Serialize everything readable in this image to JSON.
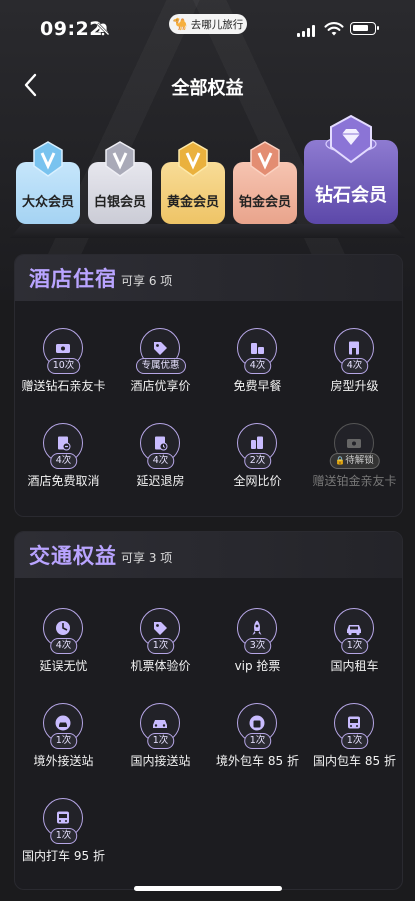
{
  "status": {
    "time": "09:22",
    "app_name": "去哪儿旅行"
  },
  "header": {
    "title": "全部权益"
  },
  "tiers": [
    {
      "label": "大众会员"
    },
    {
      "label": "白银会员"
    },
    {
      "label": "黄金会员"
    },
    {
      "label": "铂金会员"
    },
    {
      "label": "钻石会员",
      "selected": true
    }
  ],
  "hotel": {
    "title": "酒店住宿",
    "subtitle": "可享 6 项",
    "items": [
      {
        "badge": "10次",
        "label": "赠送钻石亲友卡",
        "icon": "ticket-icon"
      },
      {
        "badge": "专属优惠",
        "label": "酒店优享价",
        "icon": "price-tag-icon"
      },
      {
        "badge": "4次",
        "label": "免费早餐",
        "icon": "breakfast-icon"
      },
      {
        "badge": "4次",
        "label": "房型升级",
        "icon": "room-upgrade-icon"
      },
      {
        "badge": "4次",
        "label": "酒店免费取消",
        "icon": "cancel-doc-icon"
      },
      {
        "badge": "4次",
        "label": "延迟退房",
        "icon": "late-checkout-icon"
      },
      {
        "badge": "2次",
        "label": "全网比价",
        "icon": "price-compare-icon"
      },
      {
        "badge": "待解锁",
        "label": "赠送铂金亲友卡",
        "icon": "locked-ticket-icon",
        "locked": true
      }
    ]
  },
  "traffic": {
    "title": "交通权益",
    "subtitle": "可享 3 项",
    "items": [
      {
        "badge": "4次",
        "label": "延误无忧",
        "icon": "delay-clock-icon"
      },
      {
        "badge": "1次",
        "label": "机票体验价",
        "icon": "price-tag-icon"
      },
      {
        "badge": "3次",
        "label": "vip 抢票",
        "icon": "rocket-icon"
      },
      {
        "badge": "1次",
        "label": "国内租车",
        "icon": "car-icon"
      },
      {
        "badge": "1次",
        "label": "境外接送站",
        "icon": "globe-car-icon"
      },
      {
        "badge": "1次",
        "label": "国内接送站",
        "icon": "car-front-icon"
      },
      {
        "badge": "1次",
        "label": "境外包车 85 折",
        "icon": "globe-bus-icon"
      },
      {
        "badge": "1次",
        "label": "国内包车 85 折",
        "icon": "bus-icon"
      },
      {
        "badge": "1次",
        "label": "国内打车 95 折",
        "icon": "bus-icon"
      }
    ]
  },
  "colors": {
    "accent": "#b9a4ff",
    "circle_border": "#b6a6e6",
    "background": "#1b1b1d"
  }
}
